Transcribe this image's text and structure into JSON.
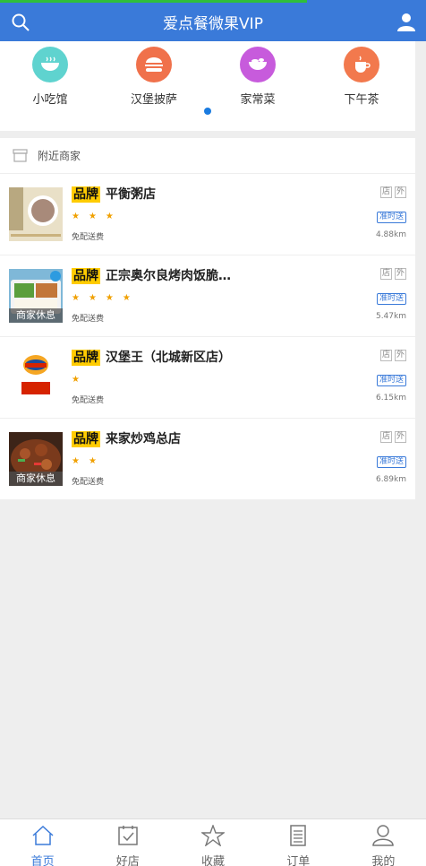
{
  "page_load_progress": 0.72,
  "header": {
    "title": "爱点餐微果VIP"
  },
  "categories": [
    {
      "label": "小吃馆",
      "color": "#5fd3cf",
      "icon": "bowl-icon"
    },
    {
      "label": "汉堡披萨",
      "color": "#f0714b",
      "icon": "burger-icon"
    },
    {
      "label": "家常菜",
      "color": "#c75bdc",
      "icon": "dish-icon"
    },
    {
      "label": "下午茶",
      "color": "#f2794d",
      "icon": "teacup-icon"
    }
  ],
  "nearby": {
    "title": "附近商家"
  },
  "shops": [
    {
      "brand": "品牌",
      "name": "平衡粥店",
      "stars": 3,
      "fee": "免配送费",
      "badge_store": "店",
      "badge_out": "外",
      "ontime": "准时送",
      "distance": "4.88km",
      "resting": ""
    },
    {
      "brand": "品牌",
      "name": "正宗奥尔良烤肉饭脆…",
      "stars": 4,
      "fee": "免配送费",
      "badge_store": "店",
      "badge_out": "外",
      "ontime": "准时送",
      "distance": "5.47km",
      "resting": "商家休息"
    },
    {
      "brand": "品牌",
      "name": "汉堡王（北城新区店）",
      "stars": 1,
      "fee": "免配送费",
      "badge_store": "店",
      "badge_out": "外",
      "ontime": "准时送",
      "distance": "6.15km",
      "resting": ""
    },
    {
      "brand": "品牌",
      "name": "来家炒鸡总店",
      "stars": 2,
      "fee": "免配送费",
      "badge_store": "店",
      "badge_out": "外",
      "ontime": "准时送",
      "distance": "6.89km",
      "resting": "商家休息"
    }
  ],
  "tabs": [
    {
      "label": "首页",
      "icon": "home-icon"
    },
    {
      "label": "好店",
      "icon": "calendar-check-icon"
    },
    {
      "label": "收藏",
      "icon": "star-icon"
    },
    {
      "label": "订单",
      "icon": "document-icon"
    },
    {
      "label": "我的",
      "icon": "user-icon"
    }
  ],
  "colors": {
    "primary": "#3a7ad9",
    "star": "#f0a000",
    "brand_bg": "#ffcc00",
    "progress": "#2fbf3a"
  }
}
